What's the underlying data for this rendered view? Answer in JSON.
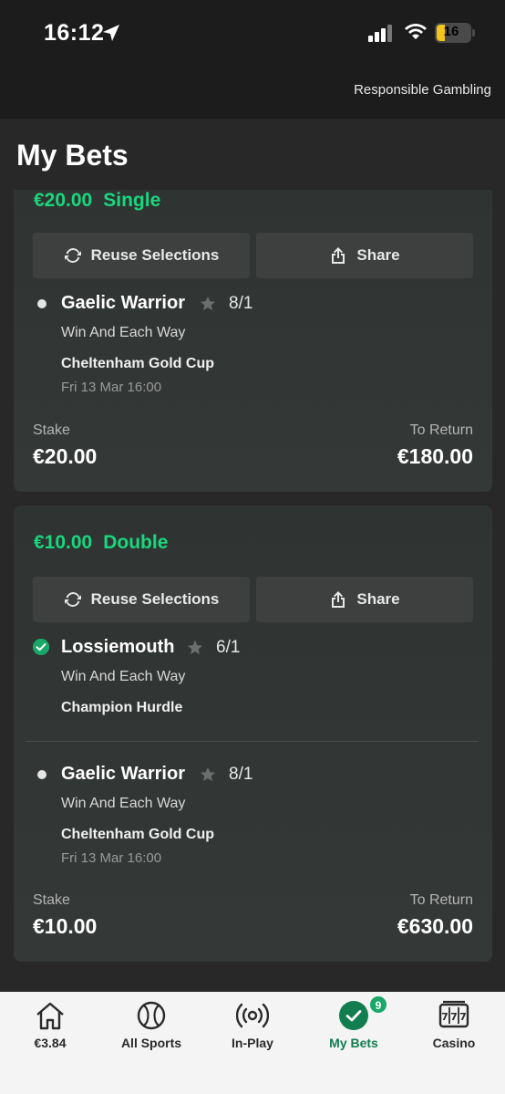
{
  "status_bar": {
    "time": "16:12",
    "battery": "16"
  },
  "header": {
    "responsible_gambling": "Responsible Gambling"
  },
  "page_title": "My Bets",
  "bets": [
    {
      "amount": "€20.00",
      "type": "Single",
      "reuse_label": "Reuse Selections",
      "share_label": "Share",
      "selections": [
        {
          "name": "Gaelic Warrior",
          "odds": "8/1",
          "market": "Win And Each Way",
          "event": "Cheltenham Gold Cup",
          "time": "Fri 13 Mar 16:00",
          "status": "open"
        }
      ],
      "stake_label": "Stake",
      "stake": "€20.00",
      "return_label": "To Return",
      "to_return": "€180.00"
    },
    {
      "amount": "€10.00",
      "type": "Double",
      "reuse_label": "Reuse Selections",
      "share_label": "Share",
      "selections": [
        {
          "name": "Lossiemouth",
          "odds": "6/1",
          "market": "Win And Each Way",
          "event": "Champion Hurdle",
          "status": "won"
        },
        {
          "name": "Gaelic Warrior",
          "odds": "8/1",
          "market": "Win And Each Way",
          "event": "Cheltenham Gold Cup",
          "time": "Fri 13 Mar 16:00",
          "status": "open"
        }
      ],
      "stake_label": "Stake",
      "stake": "€10.00",
      "return_label": "To Return",
      "to_return": "€630.00"
    }
  ],
  "tab_bar": {
    "tabs": [
      {
        "label": "€3.84",
        "icon": "home-icon"
      },
      {
        "label": "All Sports",
        "icon": "tennis-ball-icon"
      },
      {
        "label": "In-Play",
        "icon": "live-broadcast-icon"
      },
      {
        "label": "My Bets",
        "icon": "check-circle-icon",
        "badge": "9",
        "active": true
      },
      {
        "label": "Casino",
        "icon": "slot-machine-icon"
      }
    ]
  },
  "colors": {
    "accent": "#19d77e",
    "active_tab": "#127d4e",
    "card_bg": "#313533",
    "page_bg": "#282828"
  }
}
